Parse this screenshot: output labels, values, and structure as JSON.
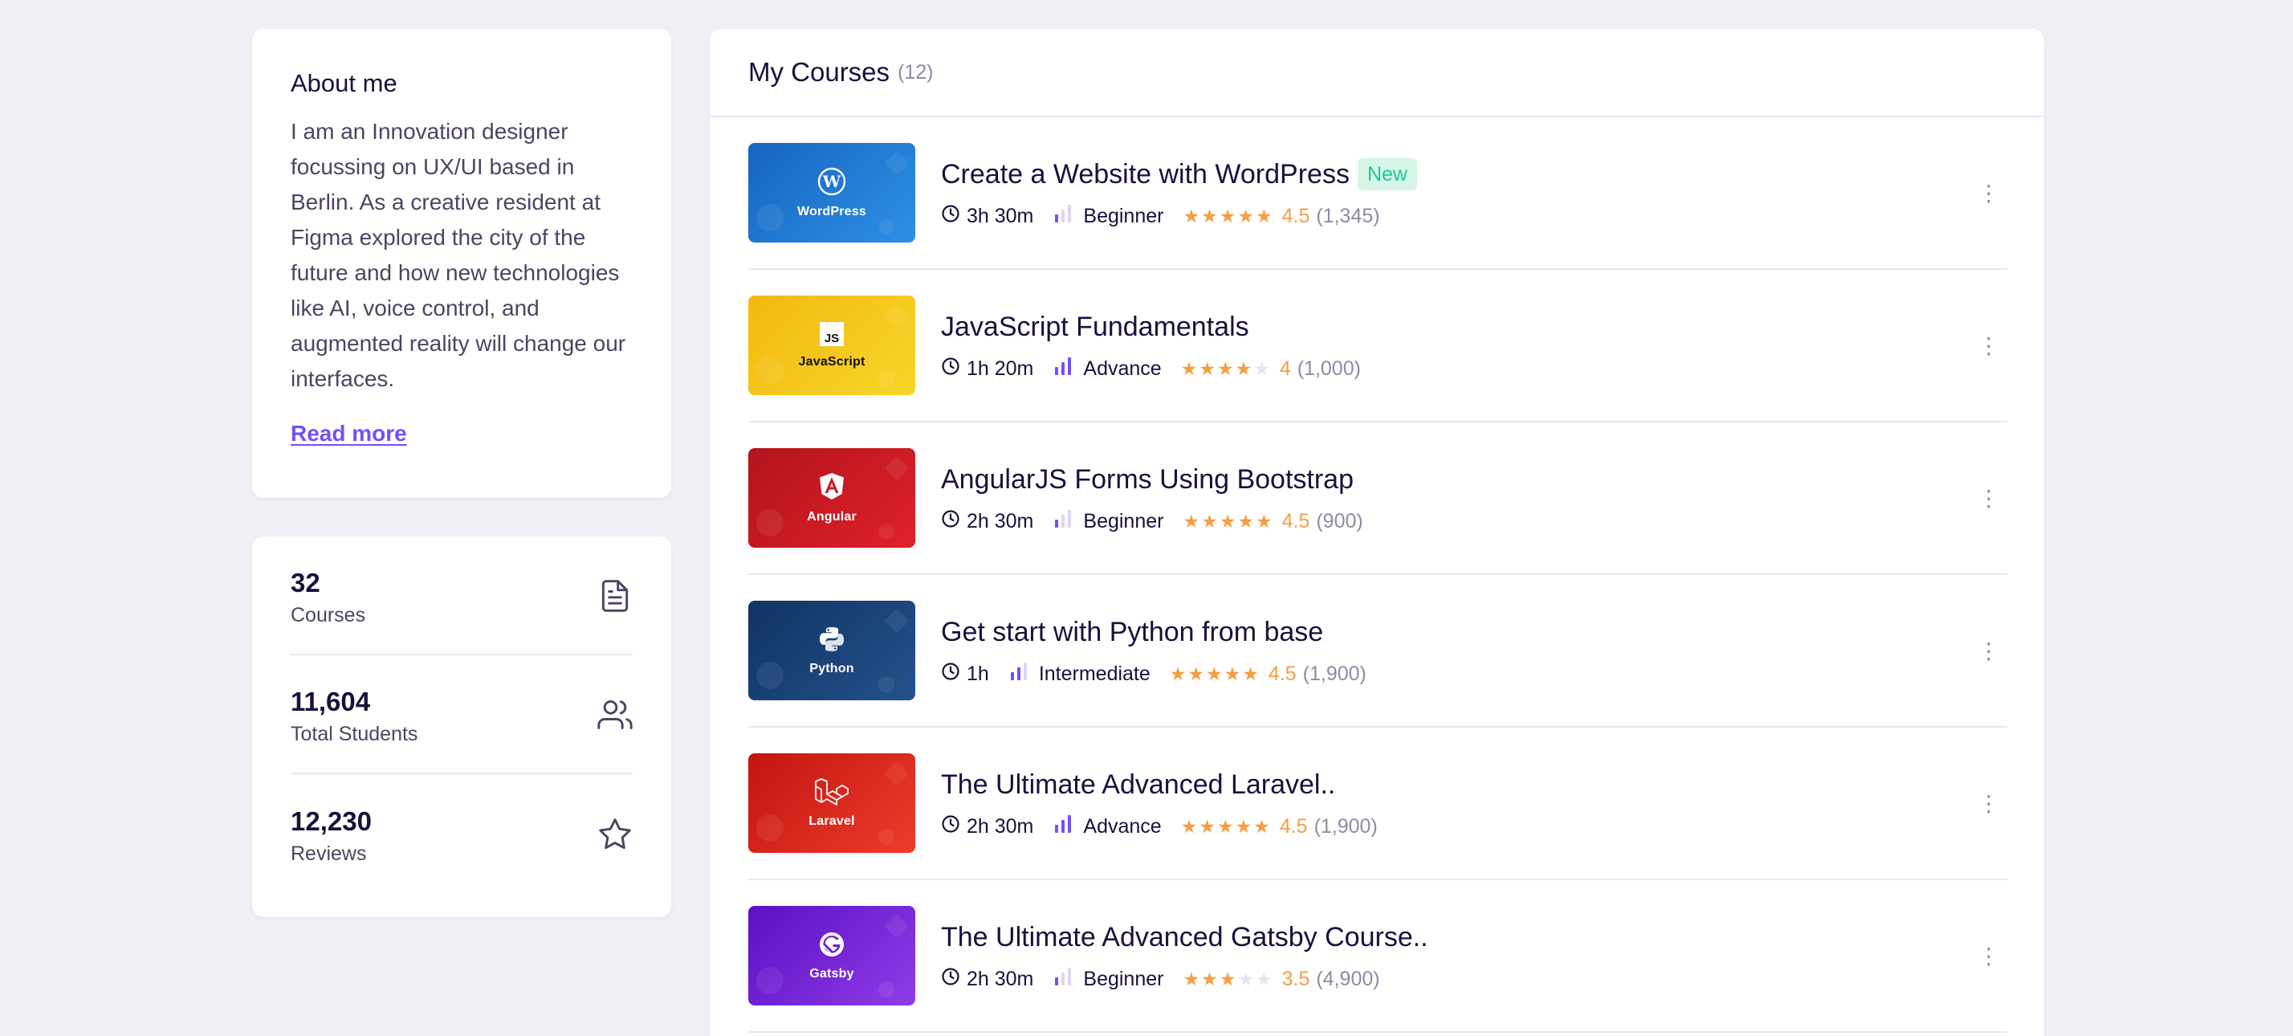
{
  "about": {
    "title": "About me",
    "text": "I am an Innovation designer focussing on UX/UI based in Berlin. As a creative resident at Figma explored the city of the future and how new technologies like AI, voice control, and augmented reality will change our interfaces.",
    "read_more": "Read more"
  },
  "stats": [
    {
      "value": "32",
      "label": "Courses",
      "icon": "document-icon"
    },
    {
      "value": "11,604",
      "label": "Total Students",
      "icon": "users-icon"
    },
    {
      "value": "12,230",
      "label": "Reviews",
      "icon": "star-icon"
    }
  ],
  "courses_panel": {
    "title": "My Courses",
    "count": "(12)"
  },
  "courses": [
    {
      "title": "Create a Website with WordPress",
      "badge": "New",
      "duration": "3h 30m",
      "level": "Beginner",
      "level_bars": 1,
      "stars": 5,
      "rating": "4.5",
      "reviews": "(1,345)",
      "thumb_label": "WordPress",
      "thumb_icon": "wordpress-icon",
      "color_from": "#1565c0",
      "color_to": "#2e8fe6"
    },
    {
      "title": "JavaScript Fundamentals",
      "badge": "",
      "duration": "1h 20m",
      "level": "Advance",
      "level_bars": 3,
      "stars": 4,
      "rating": "4",
      "reviews": "(1,000)",
      "thumb_label": "JavaScript",
      "thumb_icon": "js-icon",
      "color_from": "#f2b90f",
      "color_to": "#f7d52a"
    },
    {
      "title": "AngularJS Forms Using Bootstrap",
      "badge": "",
      "duration": "2h 30m",
      "level": "Beginner",
      "level_bars": 1,
      "stars": 5,
      "rating": "4.5",
      "reviews": "(900)",
      "thumb_label": "Angular",
      "thumb_icon": "angular-icon",
      "color_from": "#b3141c",
      "color_to": "#e0202a"
    },
    {
      "title": "Get start with Python from base",
      "badge": "",
      "duration": "1h",
      "level": "Intermediate",
      "level_bars": 2,
      "stars": 5,
      "rating": "4.5",
      "reviews": "(1,900)",
      "thumb_label": "Python",
      "thumb_icon": "python-icon",
      "color_from": "#103463",
      "color_to": "#24518c"
    },
    {
      "title": "The Ultimate Advanced Laravel..",
      "badge": "",
      "duration": "2h 30m",
      "level": "Advance",
      "level_bars": 3,
      "stars": 5,
      "rating": "4.5",
      "reviews": "(1,900)",
      "thumb_label": "Laravel",
      "thumb_icon": "laravel-icon",
      "color_from": "#c3150f",
      "color_to": "#ee3b2c"
    },
    {
      "title": "The Ultimate Advanced Gatsby Course..",
      "badge": "",
      "duration": "2h 30m",
      "level": "Beginner",
      "level_bars": 1,
      "stars": 3,
      "rating": "3.5",
      "reviews": "(4,900)",
      "thumb_label": "Gatsby",
      "thumb_icon": "gatsby-icon",
      "color_from": "#5a10c4",
      "color_to": "#8f3ce6"
    }
  ],
  "colors": {
    "accent": "#754ffe",
    "star": "#f59e42",
    "badge_bg": "#d6f5e6",
    "badge_text": "#19cb98"
  }
}
